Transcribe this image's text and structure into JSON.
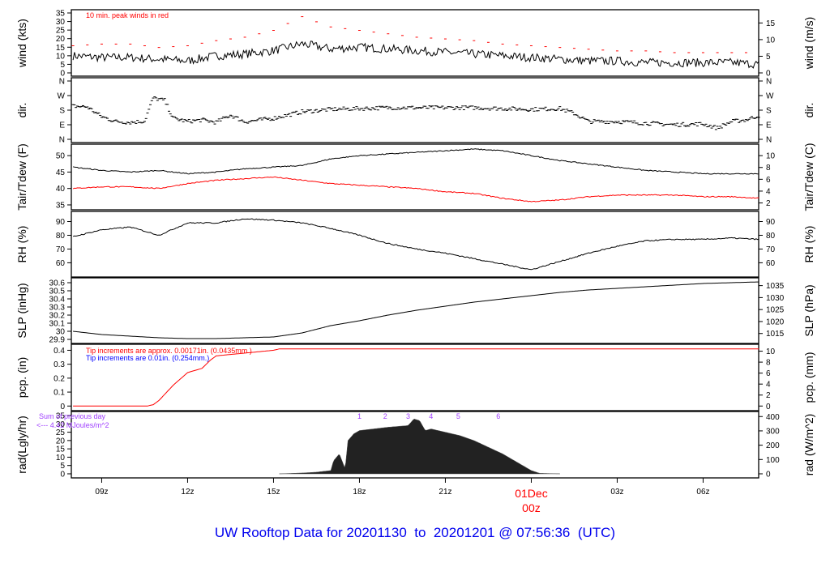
{
  "title": "UW Rooftop Data for 20201130  to  20201201 @ 07:56:36  (UTC)",
  "chart_data": {
    "type": "line",
    "time_range_hours": [
      7.94,
      31.94
    ],
    "x_ticks": [
      {
        "h": 9,
        "label": "09z"
      },
      {
        "h": 12,
        "label": "12z"
      },
      {
        "h": 15,
        "label": "15z"
      },
      {
        "h": 18,
        "label": "18z"
      },
      {
        "h": 21,
        "label": "21z"
      },
      {
        "h": 24,
        "label": "01Dec",
        "label2": "00z",
        "color": "#ff0000"
      },
      {
        "h": 27,
        "label": "03z"
      },
      {
        "h": 30,
        "label": "06z"
      }
    ],
    "hours": [
      8,
      9,
      10,
      11,
      12,
      13,
      14,
      15,
      16,
      17,
      18,
      19,
      20,
      21,
      22,
      23,
      24,
      25,
      26,
      27,
      28,
      29,
      30,
      31,
      32
    ],
    "panels": [
      {
        "id": "wind",
        "ylabel": "wind (kts)",
        "ylabel_right": "wind (m/s)",
        "ylim": [
          0,
          35
        ],
        "yticks": [
          0,
          5,
          10,
          15,
          20,
          25,
          30,
          35
        ],
        "right_lim": [
          0,
          18
        ],
        "right_ticks": [
          0,
          5,
          10,
          15
        ],
        "annotation": {
          "text": "10 min. peak winds in red",
          "color": "#ff0000"
        },
        "series": [
          {
            "name": "wind speed",
            "color": "#000000",
            "values": [
              10,
              9,
              9,
              8,
              7,
              10,
              11,
              13,
              17,
              14,
              15,
              14,
              13,
              12,
              11,
              10,
              9,
              8,
              7,
              7,
              6,
              6,
              6,
              6,
              5
            ]
          },
          {
            "name": "10 min peak",
            "color": "#ff0000",
            "style": "dash",
            "values": [
              13,
              14,
              14,
              12,
              13,
              16,
              18,
              22,
              30,
              24,
              22,
              20,
              18,
              17,
              16,
              14,
              13,
              12,
              11,
              10,
              10,
              9,
              9,
              9,
              9
            ]
          }
        ]
      },
      {
        "id": "dir",
        "ylabel": "dir.",
        "ylabel_right": "dir.",
        "ylim": [
          0,
          360
        ],
        "yticks": [
          {
            "v": 0,
            "l": "N"
          },
          {
            "v": 90,
            "l": "E"
          },
          {
            "v": 180,
            "l": "S"
          },
          {
            "v": 270,
            "l": "W"
          },
          {
            "v": 360,
            "l": "N"
          }
        ],
        "series": [
          {
            "name": "wind direction",
            "color": "#000000",
            "style": "dash",
            "x": [
              8,
              8.5,
              9,
              9.5,
              10,
              10.5,
              10.8,
              11.2,
              11.5,
              12,
              12.5,
              13,
              13.5,
              14,
              15,
              16,
              17,
              18,
              19,
              20,
              21,
              22,
              23,
              24,
              25,
              25.5,
              26,
              27,
              28,
              29,
              30,
              30.5,
              31,
              31.5,
              32
            ],
            "values": [
              205,
              200,
              140,
              110,
              105,
              112,
              255,
              240,
              130,
              110,
              120,
              105,
              150,
              108,
              130,
              170,
              185,
              190,
              195,
              195,
              195,
              195,
              190,
              185,
              190,
              160,
              110,
              110,
              100,
              90,
              95,
              70,
              110,
              120,
              150
            ]
          }
        ]
      },
      {
        "id": "temp",
        "ylabel": "Tair/Tdew (F)",
        "ylabel_right": "Tair/Tdew (C)",
        "ylim": [
          34.5,
          52.5
        ],
        "yticks": [
          35,
          40,
          45,
          50
        ],
        "right_lim": [
          1.39,
          11.39
        ],
        "right_ticks": [
          2,
          4,
          6,
          8,
          10
        ],
        "series": [
          {
            "name": "Tair",
            "color": "#000000",
            "values": [
              46.5,
              45.5,
              45,
              45.5,
              44.5,
              45,
              46,
              46.5,
              47,
              49,
              50,
              50.5,
              51,
              51.5,
              52,
              51.5,
              50,
              48.5,
              47.5,
              46.5,
              45.5,
              45,
              44.5,
              44.5,
              44.5
            ]
          },
          {
            "name": "Tdew",
            "color": "#ff0000",
            "values": [
              40,
              40.5,
              40.5,
              40,
              41.5,
              42.5,
              43,
              43.5,
              42.5,
              41.5,
              41,
              40.5,
              40,
              39,
              38.5,
              37,
              36,
              36.5,
              37.5,
              38,
              38,
              38,
              37.5,
              37.5,
              37
            ]
          }
        ]
      },
      {
        "id": "rh",
        "ylabel": "RH (%)",
        "ylabel_right": "RH (%)",
        "ylim": [
          52,
          95
        ],
        "yticks": [
          60,
          70,
          80,
          90
        ],
        "right_lim": [
          52,
          95
        ],
        "right_ticks": [
          60,
          70,
          80,
          90
        ],
        "series": [
          {
            "name": "RH",
            "color": "#000000",
            "values": [
              79,
              84,
              86,
              80,
              89,
              89,
              92,
              91,
              89,
              85,
              80,
              74,
              70,
              67,
              63,
              59,
              55,
              61,
              67,
              72,
              76,
              77,
              77,
              78,
              77
            ]
          }
        ]
      },
      {
        "id": "slp",
        "ylabel": "SLP (inHg)",
        "ylabel_right": "SLP (hPa)",
        "ylim": [
          29.89,
          30.62
        ],
        "yticks": [
          29.9,
          30.0,
          30.1,
          30.2,
          30.3,
          30.4,
          30.5,
          30.6
        ],
        "right_lim": [
          1012.2,
          1036.9
        ],
        "right_ticks": [
          1015,
          1020,
          1025,
          1030,
          1035
        ],
        "series": [
          {
            "name": "SLP",
            "color": "#000000",
            "values": [
              30.0,
              29.96,
              29.94,
              29.92,
              29.91,
              29.91,
              29.92,
              29.93,
              29.98,
              30.07,
              30.13,
              30.2,
              30.26,
              30.31,
              30.36,
              30.4,
              30.44,
              30.48,
              30.51,
              30.53,
              30.55,
              30.57,
              30.59,
              30.6,
              30.61
            ]
          }
        ]
      },
      {
        "id": "pcp",
        "ylabel": "pcp. (in)",
        "ylabel_right": "pcp. (mm)",
        "ylim": [
          -0.01,
          0.42
        ],
        "yticks": [
          0.0,
          0.1,
          0.2,
          0.3,
          0.4
        ],
        "right_lim": [
          -0.254,
          10.67
        ],
        "right_ticks": [
          0,
          2,
          4,
          6,
          8,
          10
        ],
        "annotations": [
          {
            "text": "Tip increments are approx. 0.00171in. (0.0435mm.)",
            "color": "#ff0000"
          },
          {
            "text": "Tip increments are 0.01in. (0.254mm.)",
            "color": "#0000ff"
          }
        ],
        "series": [
          {
            "name": "precip",
            "color": "#ff0000",
            "x": [
              8,
              10.6,
              10.8,
              11,
              11.5,
              12,
              12.5,
              12.8,
              13,
              13.5,
              14,
              14.5,
              15,
              15.2,
              16,
              32
            ],
            "values": [
              0,
              0,
              0.01,
              0.04,
              0.15,
              0.24,
              0.27,
              0.33,
              0.36,
              0.37,
              0.38,
              0.39,
              0.4,
              0.41,
              0.41,
              0.41
            ]
          }
        ]
      },
      {
        "id": "rad",
        "ylabel": "rad(Lgly/hr)",
        "ylabel_right": "rad (W/m^2)",
        "ylim": [
          -0.5,
          35.5
        ],
        "yticks": [
          0,
          5,
          10,
          15,
          20,
          25,
          30,
          35
        ],
        "right_lim": [
          -5.8,
          412.8
        ],
        "right_ticks": [
          0,
          100,
          200,
          300,
          400
        ],
        "annotations": [
          {
            "text": "Sum of previous day",
            "color": "#a040ff"
          },
          {
            "text": "<--- 4.42 MJoules/m^2",
            "color": "#a040ff"
          }
        ],
        "hour_marks": [
          {
            "h": 18,
            "l": "1"
          },
          {
            "h": 18.9,
            "l": "2"
          },
          {
            "h": 19.7,
            "l": "3"
          },
          {
            "h": 20.5,
            "l": "4"
          },
          {
            "h": 21.45,
            "l": "5"
          },
          {
            "h": 22.85,
            "l": "6"
          }
        ],
        "series": [
          {
            "name": "radiation",
            "color": "#222222",
            "style": "area",
            "x": [
              15.2,
              16,
              16.5,
              17,
              17.1,
              17.3,
              17.5,
              17.6,
              17.8,
              18,
              18.5,
              19,
              19.7,
              19.9,
              20.1,
              20.3,
              20.5,
              21,
              21.5,
              22,
              22.5,
              23,
              23.5,
              24,
              24.3,
              25
            ],
            "values": [
              0,
              0.5,
              1,
              2,
              8,
              12,
              3,
              20,
              24,
              26,
              27,
              28,
              29,
              33,
              32,
              26,
              27,
              25,
              23,
              20,
              16,
              12,
              7,
              2,
              0.3,
              0
            ]
          }
        ]
      }
    ]
  }
}
